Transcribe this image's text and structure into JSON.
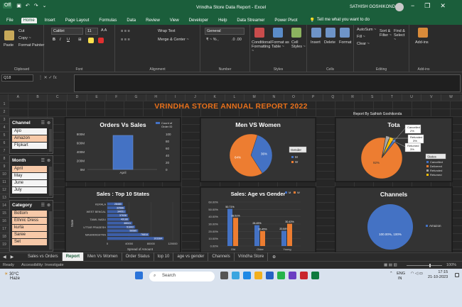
{
  "window": {
    "title": "Vrindha Store Data Report  -  Excel",
    "user": "SATHISH GOSHIKONDA",
    "autosave": "Off",
    "controls": [
      "−",
      "❐",
      "✕"
    ]
  },
  "ribbon_tabs": [
    "File",
    "Home",
    "Insert",
    "Page Layout",
    "Formulas",
    "Data",
    "Review",
    "View",
    "Developer",
    "Help",
    "Data Streamer",
    "Power Pivot"
  ],
  "active_tab": "Home",
  "tell_me": "Tell me what you want to do",
  "ribbon": {
    "clipboard": {
      "label": "Clipboard",
      "paste": "Paste",
      "cut": "Cut",
      "copy": "Copy ~",
      "format_painter": "Format Painter"
    },
    "font": {
      "label": "Font",
      "name": "Calibri",
      "size": "11"
    },
    "alignment": {
      "label": "Alignment",
      "wrap": "Wrap Text",
      "merge": "Merge & Center ~"
    },
    "number": {
      "label": "Number",
      "format": "General"
    },
    "styles": {
      "label": "Styles",
      "conditional": "Conditional Formatting ~",
      "format_table": "Format as Table ~",
      "cell_styles": "Cell Styles ~"
    },
    "cells": {
      "label": "Cells",
      "insert": "Insert",
      "delete": "Delete",
      "format": "Format"
    },
    "editing": {
      "label": "Editing",
      "autosum": "AutoSum ~",
      "fill": "Fill ~",
      "clear": "Clear ~",
      "sort": "Sort & Filter ~",
      "find": "Find & Select ~"
    },
    "addins": {
      "label": "Add-ins",
      "btn": "Add-ins"
    }
  },
  "formula_bar": {
    "name_box": "Q18",
    "content": ""
  },
  "columns": [
    "A",
    "B",
    "C",
    "D",
    "E",
    "F",
    "G",
    "H",
    "I",
    "J",
    "K",
    "L",
    "M",
    "N",
    "O",
    "P",
    "Q",
    "R",
    "S",
    "T",
    "U",
    "V",
    "W"
  ],
  "rows": [
    "1",
    "2",
    "3",
    "4",
    "5",
    "6",
    "7",
    "8",
    "9",
    "10",
    "11",
    "12",
    "13",
    "14",
    "15",
    "16",
    "17",
    "18",
    "19"
  ],
  "dashboard": {
    "banner": "VRINDHA STORE ANNUAL REPORT 2022",
    "report_by": "Report By Sathish Goshikonda"
  },
  "slicers": {
    "channel": {
      "title": "Channel",
      "items": [
        {
          "label": "Ajio",
          "sel": false
        },
        {
          "label": "Amazon",
          "sel": true
        },
        {
          "label": "Flipkart",
          "sel": false
        }
      ]
    },
    "month": {
      "title": "Month",
      "items": [
        {
          "label": "April",
          "sel": true
        },
        {
          "label": "May",
          "sel": false
        },
        {
          "label": "June",
          "sel": false
        },
        {
          "label": "July",
          "sel": false
        }
      ]
    },
    "category": {
      "title": "Category",
      "items": [
        {
          "label": "Bottom",
          "sel": true
        },
        {
          "label": "Ethnic Dress",
          "sel": true
        },
        {
          "label": "kurta",
          "sel": true
        },
        {
          "label": "Saree",
          "sel": true
        },
        {
          "label": "Set",
          "sel": true
        }
      ]
    }
  },
  "chart_data": [
    {
      "id": "orders_vs_sales",
      "type": "bar",
      "title": "Orders Vs Sales",
      "categories": [
        "April"
      ],
      "legend": "Count of Order ID",
      "left_ticks": [
        "800M",
        "600M",
        "400M",
        "200M",
        "0M"
      ],
      "right_ticks": [
        "100",
        "80",
        "60",
        "40",
        "20",
        "0"
      ],
      "values": [
        96
      ],
      "ylim": [
        0,
        100
      ]
    },
    {
      "id": "men_vs_women",
      "type": "pie",
      "title": "Men VS Women",
      "legend_title": "Gender",
      "series": [
        {
          "name": "M",
          "value": 36,
          "label": "36%",
          "color": "#4472c4"
        },
        {
          "name": "W",
          "value": 64,
          "label": "64%",
          "color": "#ed7d31"
        }
      ]
    },
    {
      "id": "order_status",
      "type": "pie",
      "title": "Tota",
      "legend_title": "Status",
      "series": [
        {
          "name": "Cancelled",
          "value": 2,
          "label": "Cancelled 2%",
          "color": "#4472c4"
        },
        {
          "name": "Delivered",
          "value": 92,
          "label": "92%",
          "color": "#ed7d31"
        },
        {
          "name": "Refunded",
          "value": 3,
          "label": "Refunded 3%",
          "color": "#a5a5a5"
        },
        {
          "name": "Returned",
          "value": 3,
          "label": "Returned 3%",
          "color": "#ffc000"
        }
      ]
    },
    {
      "id": "top10_states",
      "type": "bar",
      "title": "Sales : Top 10 States",
      "orientation": "horizontal",
      "xlabel": "Spread of Amount",
      "ylabel": "State",
      "categories": [
        "KERALA",
        "",
        "WEST BENGAL",
        "",
        "TAMIL NADU",
        "",
        "UTTAR PRADESH",
        "",
        "MAHARASHTRA",
        ""
      ],
      "values": [
        28480,
        32566,
        34051,
        37638,
        40188,
        46041,
        51002,
        56580,
        76818,
        103384
      ],
      "value_labels": [
        "28480",
        "32566",
        "34051",
        "37638",
        "40188",
        "46041",
        "51002",
        "56580",
        "76818",
        "103384"
      ],
      "x_ticks": [
        "0",
        "40000",
        "80000",
        "120000"
      ],
      "xlim": [
        0,
        120000
      ]
    },
    {
      "id": "age_vs_gender",
      "type": "bar",
      "title": "Sales: Age vs Gender",
      "categories": [
        "Old",
        "Older",
        "Young"
      ],
      "series": [
        {
          "name": "M",
          "values": [
            50.71,
            28.45,
            20.84
          ],
          "labels": [
            "50.71%",
            "28.45%",
            "20.84%"
          ],
          "color": "#4472c4"
        },
        {
          "name": "W",
          "values": [
            38.51,
            20.45,
            30.43
          ],
          "labels": [
            "38.51%",
            "20.45%",
            "30.43%"
          ],
          "color": "#ed7d31"
        }
      ],
      "y_ticks": [
        "60.00%",
        "50.00%",
        "40.00%",
        "30.00%",
        "20.00%",
        "10.00%",
        "0.00%"
      ],
      "ylim": [
        0,
        60
      ]
    },
    {
      "id": "channels",
      "type": "pie",
      "title": "Channels",
      "series": [
        {
          "name": "Amazon",
          "value": 100,
          "label": "100.00%, 100%",
          "color": "#4472c4"
        }
      ]
    }
  ],
  "sheet_tabs": [
    "Sales vs Orders",
    "Report",
    "Men Vs Women",
    "Order Status",
    "top 10",
    "age vs gender",
    "Channels",
    "Vrindha Store"
  ],
  "active_sheet": "Report",
  "status": {
    "ready": "Ready",
    "accessibility": "Accessibility: Investigate",
    "zoom": "100%"
  },
  "taskbar": {
    "weather_temp": "30°C",
    "weather_desc": "Haze",
    "search": "Search",
    "lang": "ENG",
    "region": "IN",
    "time": "17:15",
    "date": "21-10-2023"
  }
}
